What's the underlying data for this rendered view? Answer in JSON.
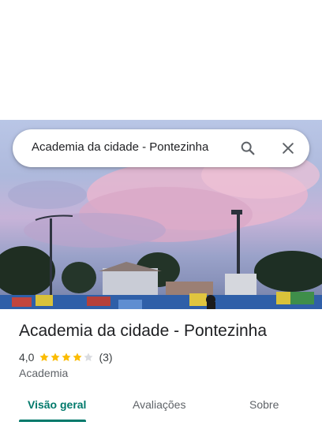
{
  "search": {
    "query": "Academia da cidade - Pontezinha",
    "search_icon": "search-icon",
    "close_icon": "close-icon"
  },
  "place": {
    "title": "Academia da cidade - Pontezinha",
    "rating": "4,0",
    "rating_fraction": 0.8,
    "stars_filled": 4,
    "stars_total": 5,
    "review_count": "(3)",
    "category": "Academia"
  },
  "tabs": [
    {
      "label": "Visão geral",
      "active": true
    },
    {
      "label": "Avaliações",
      "active": false
    },
    {
      "label": "Sobre",
      "active": false
    }
  ],
  "colors": {
    "accent": "#00796b",
    "star": "#fbbc04",
    "star_empty": "#dadce0"
  }
}
